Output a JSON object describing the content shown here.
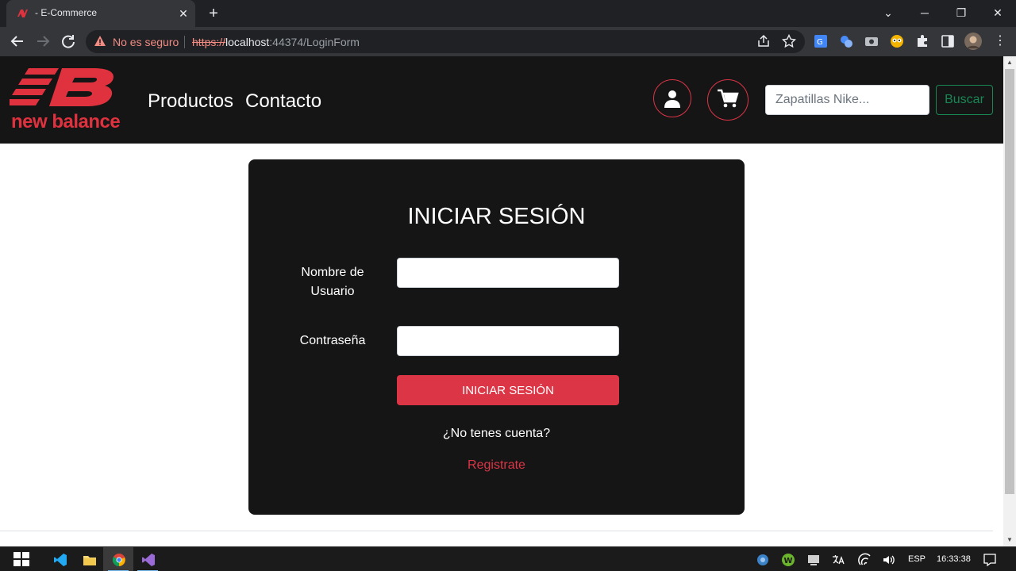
{
  "browser": {
    "tab_title": "- E-Commerce",
    "security_label": "No es seguro",
    "url_scheme": "https://",
    "url_host": "localhost",
    "url_rest": ":44374/LoginForm"
  },
  "header": {
    "logo_text": "new balance",
    "nav": [
      {
        "label": "Productos"
      },
      {
        "label": "Contacto"
      }
    ],
    "search_placeholder": "Zapatillas Nike...",
    "search_button": "Buscar",
    "colors": {
      "accent": "#dc3545",
      "search_button": "#198754",
      "header_bg": "#161516"
    }
  },
  "login": {
    "title": "INICIAR SESIÓN",
    "username_label": "Nombre de Usuario",
    "password_label": "Contraseña",
    "username_value": "",
    "password_value": "",
    "submit_label": "INICIAR SESIÓN",
    "no_account_text": "¿No tenes cuenta?",
    "register_link": "Registrate"
  },
  "taskbar": {
    "language": "ESP",
    "time": "16:33:38"
  }
}
